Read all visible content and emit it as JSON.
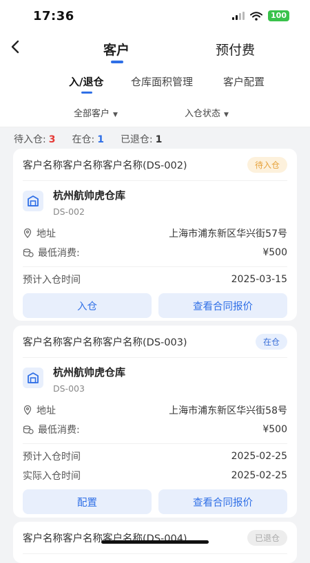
{
  "status_bar": {
    "time": "17:36",
    "battery": "100"
  },
  "nav": {
    "tabs": [
      "客户",
      "预付费"
    ]
  },
  "subtabs": [
    "入/退仓",
    "仓库面积管理",
    "客户配置"
  ],
  "filters": [
    "全部客户",
    "入仓状态"
  ],
  "summary": [
    {
      "label": "待入仓:",
      "count": "3"
    },
    {
      "label": "在仓:",
      "count": "1"
    },
    {
      "label": "已退仓:",
      "count": "1"
    }
  ],
  "cards": [
    {
      "customer": "客户名称客户名称客户名称(DS-002)",
      "status": "待入仓",
      "warehouse": "杭州航帅虎仓库",
      "code": "DS-002",
      "address_label": "地址",
      "address": "上海市浦东新区华兴街57号",
      "min_label": "最低消费:",
      "min": "¥500",
      "planned_label": "预计入仓时间",
      "planned": "2025-03-15",
      "btn1": "入仓",
      "btn2": "查看合同报价"
    },
    {
      "customer": "客户名称客户名称客户名称(DS-003)",
      "status": "在仓",
      "warehouse": "杭州航帅虎仓库",
      "code": "DS-003",
      "address_label": "地址",
      "address": "上海市浦东新区华兴街58号",
      "min_label": "最低消费:",
      "min": "¥500",
      "planned_label": "预计入仓时间",
      "planned": "2025-02-25",
      "actual_label": "实际入仓时间",
      "actual": "2025-02-25",
      "btn1": "配置",
      "btn2": "查看合同报价"
    },
    {
      "customer": "客户名称客户名称客户名称(DS-004)",
      "status": "已退仓"
    }
  ]
}
